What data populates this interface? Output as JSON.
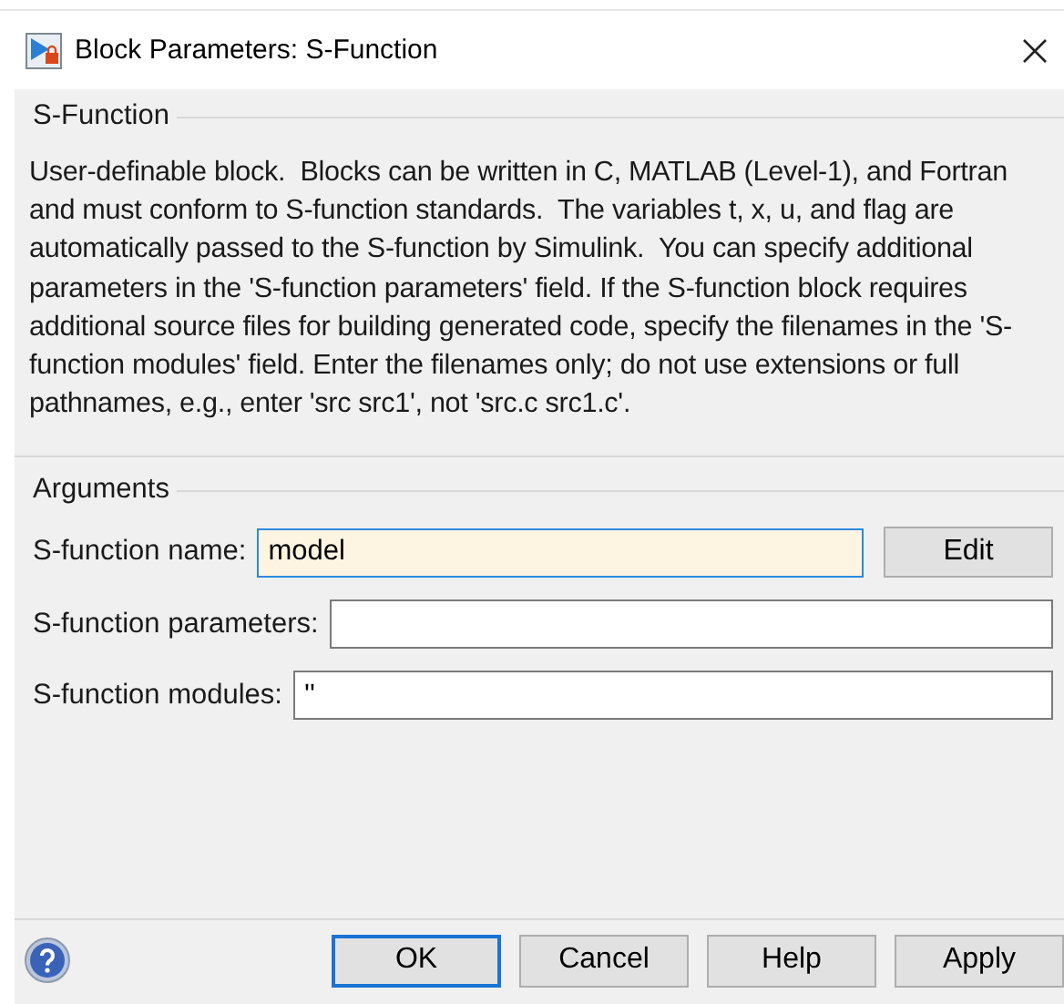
{
  "window": {
    "title": "Block Parameters: S-Function"
  },
  "description": {
    "title": "S-Function",
    "text": "User-definable block.  Blocks can be written in C, MATLAB (Level-1), and Fortran and must conform to S-function standards.  The variables t, x, u, and flag are automatically passed to the S-function by Simulink.  You can specify additional parameters in the 'S-function parameters' field. If the S-function block requires additional source files for building generated code, specify the filenames in the 'S-function modules' field. Enter the filenames only; do not use extensions or full pathnames, e.g., enter 'src src1', not 'src.c src1.c'."
  },
  "arguments": {
    "title": "Arguments",
    "fields": [
      {
        "label": "S-function name:",
        "value": "model",
        "focused": true,
        "button": "Edit"
      },
      {
        "label": "S-function parameters:",
        "focused": false
      },
      {
        "label": "S-function modules:",
        "value": "''",
        "focused": false
      }
    ]
  },
  "buttons": [
    {
      "label": "OK",
      "focused": true
    },
    {
      "label": "Cancel",
      "focused": false
    },
    {
      "label": "Help",
      "focused": false
    },
    {
      "label": "Apply",
      "focused": false
    }
  ]
}
